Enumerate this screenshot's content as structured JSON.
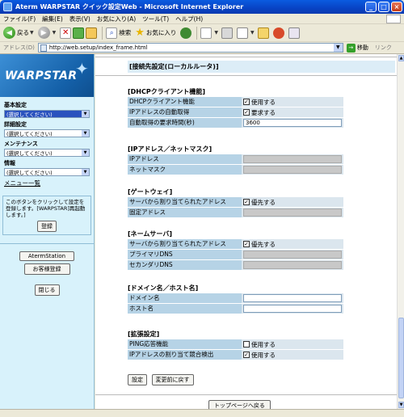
{
  "window": {
    "title": "Aterm WARPSTAR クイック設定Web - Microsoft Internet Explorer"
  },
  "menubar": {
    "items": [
      "ファイル(F)",
      "編集(E)",
      "表示(V)",
      "お気に入り(A)",
      "ツール(T)",
      "ヘルプ(H)"
    ]
  },
  "toolbar": {
    "back": "戻る",
    "search": "検索",
    "favorites": "お気に入り"
  },
  "address": {
    "label": "アドレス(D)",
    "url": "http://web.setup/index_frame.html",
    "go": "移動",
    "links": "リンク"
  },
  "sidebar": {
    "logo": "WARPSTAR",
    "groups": [
      {
        "label": "基本設定",
        "select": "(選択してください)"
      },
      {
        "label": "詳細設定",
        "select": "(選択してください)"
      },
      {
        "label": "メンテナンス",
        "select": "(選択してください)"
      },
      {
        "label": "情報",
        "select": "(選択してください)"
      }
    ],
    "menu_link": "メニュー一覧",
    "note": "このボタンをクリックして設定を登録します。[WARPSTAR]再起動します。]",
    "register_btn": "登録",
    "aterm_btn": "AtermStation",
    "customer_btn": "お客様登録",
    "close_btn": "閉じる"
  },
  "main": {
    "title": "[接続先設定(ローカルルータ)]",
    "dhcp": {
      "title": "[DHCPクライアント機能]",
      "rows": [
        {
          "label": "DHCPクライアント機能",
          "check": "使用する",
          "checked": true
        },
        {
          "label": "IPアドレスの自動取得",
          "check": "要求する",
          "checked": true
        },
        {
          "label": "自動取得の要求時間(秒)",
          "value": "3600"
        }
      ]
    },
    "ipmask": {
      "title": "[IPアドレス／ネットマスク]",
      "rows": [
        {
          "label": "IPアドレス"
        },
        {
          "label": "ネットマスク"
        }
      ]
    },
    "gateway": {
      "title": "[ゲートウェイ]",
      "rows": [
        {
          "label": "サーバから割り当てられたアドレス",
          "check": "優先する",
          "checked": true
        },
        {
          "label": "固定アドレス"
        }
      ]
    },
    "dns": {
      "title": "[ネームサーバ]",
      "rows": [
        {
          "label": "サーバから割り当てられたアドレス",
          "check": "優先する",
          "checked": true
        },
        {
          "label": "プライマリDNS"
        },
        {
          "label": "セカンダリDNS"
        }
      ]
    },
    "domain": {
      "title": "[ドメイン名／ホスト名]",
      "rows": [
        {
          "label": "ドメイン名"
        },
        {
          "label": "ホスト名"
        }
      ]
    },
    "extended": {
      "title": "[拡張設定]",
      "rows": [
        {
          "label": "PING応答機能",
          "check": "使用する",
          "checked": false
        },
        {
          "label": "IPアドレスの割り当て競合検出",
          "check": "使用する",
          "checked": true
        }
      ]
    },
    "set_btn": "設定",
    "revert_btn": "変更前に戻す",
    "top_btn": "トップページへ戻る"
  }
}
